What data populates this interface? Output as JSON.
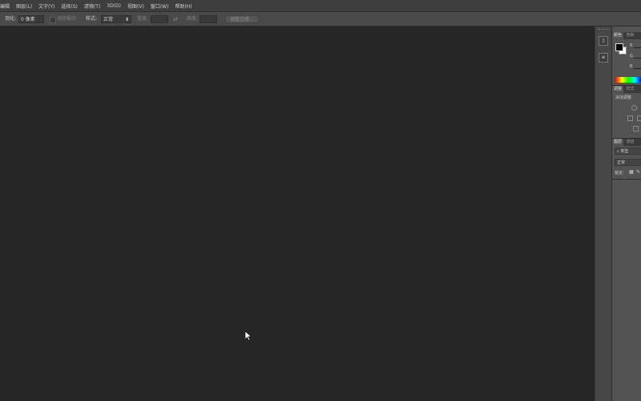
{
  "menu": {
    "items": [
      "编辑",
      "图层(L)",
      "文字(Y)",
      "选择(S)",
      "滤镜(T)",
      "3D(D)",
      "视图(V)",
      "窗口(W)",
      "帮助(H)"
    ]
  },
  "options": {
    "feather_label": "羽化:",
    "feather_value": "0 像素",
    "antialias_label": "消除锯齿",
    "style_label": "样式:",
    "style_value": "正常",
    "width_label": "宽度:",
    "height_label": "高度:",
    "refine_edge_label": "调整边缘..."
  },
  "panels": {
    "color_tabs": [
      "颜色",
      "色板"
    ],
    "rgb_labels": [
      "R",
      "G",
      "B"
    ],
    "adjust_tabs": [
      "调整",
      "样式"
    ],
    "adjust_title": "添加调整",
    "layers_tabs": [
      "图层",
      "通道"
    ],
    "kind_label": "类型",
    "blend_mode": "正常",
    "lock_label": "锁定:"
  },
  "colors": {
    "canvas": "#262626",
    "menubar": "#3e3e3e",
    "optionsbar": "#4a4a4a",
    "panel": "#535353"
  }
}
